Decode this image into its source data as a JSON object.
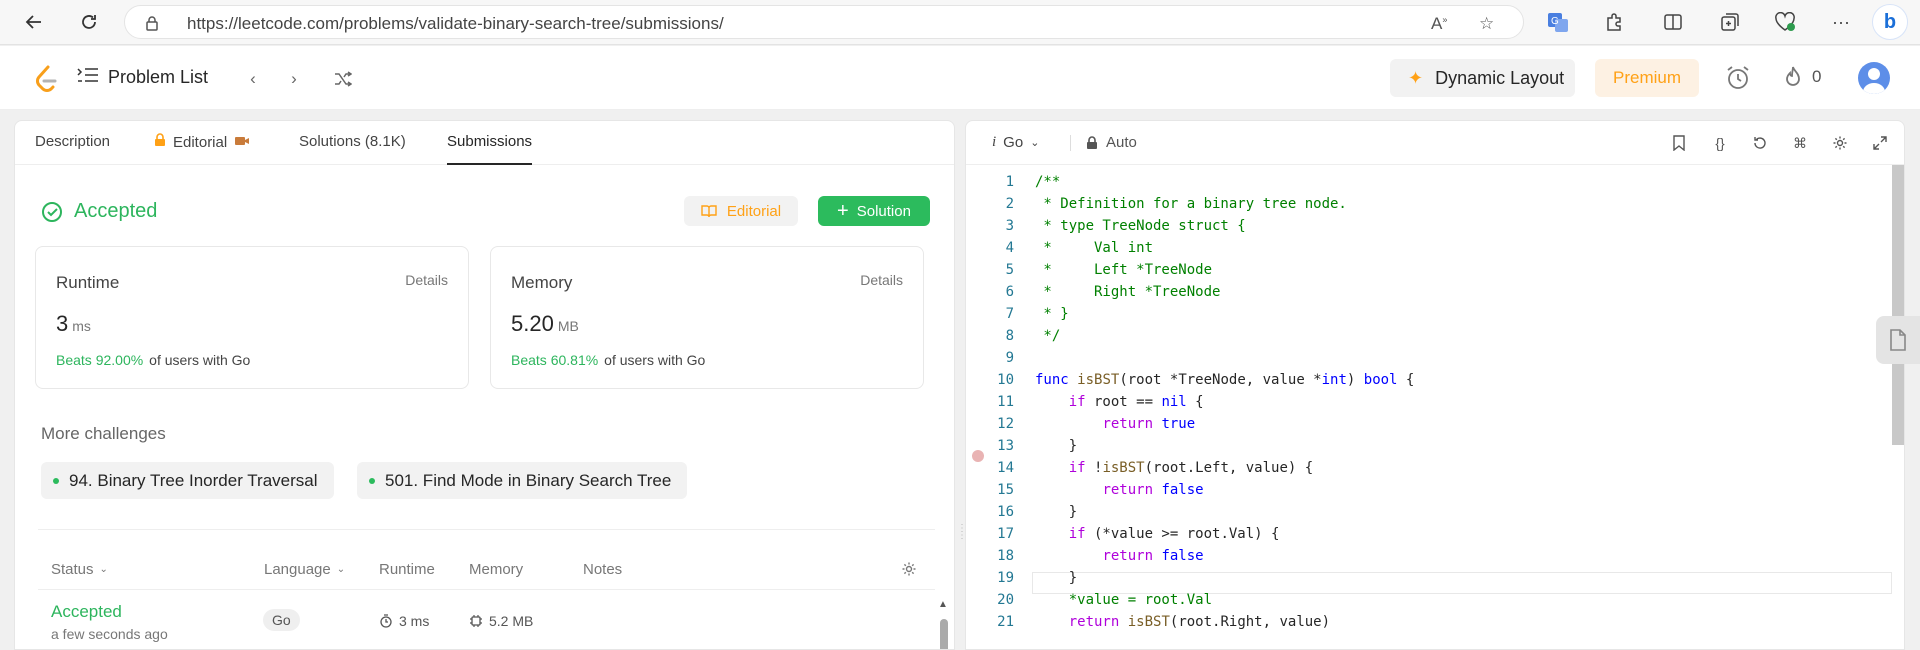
{
  "browser": {
    "url": "https://leetcode.com/problems/validate-binary-search-tree/submissions/",
    "icons": [
      "back-icon",
      "refresh-icon",
      "lock-icon",
      "read-aloud-icon",
      "favorite-star-icon",
      "translate-icon",
      "extensions-icon",
      "split-screen-icon",
      "collections-icon",
      "health-icon",
      "more-icon",
      "bing-icon"
    ]
  },
  "header": {
    "problem_list": "Problem List",
    "dynamic_layout": "Dynamic Layout",
    "premium": "Premium",
    "streak_count": "0"
  },
  "tabs": {
    "description": "Description",
    "editorial": "Editorial",
    "solutions": "Solutions (8.1K)",
    "submissions": "Submissions"
  },
  "result": {
    "status": "Accepted",
    "editorial_btn": "Editorial",
    "solution_btn": "Solution",
    "runtime": {
      "label": "Runtime",
      "details": "Details",
      "value": "3",
      "unit": "ms",
      "beats": "Beats 92.00%",
      "suffix": "of users with Go"
    },
    "memory": {
      "label": "Memory",
      "details": "Details",
      "value": "5.20",
      "unit": "MB",
      "beats": "Beats 60.81%",
      "suffix": "of users with Go"
    }
  },
  "more_challenges": {
    "title": "More challenges",
    "items": [
      "94. Binary Tree Inorder Traversal",
      "501. Find Mode in Binary Search Tree"
    ]
  },
  "table": {
    "headers": [
      "Status",
      "Language",
      "Runtime",
      "Memory",
      "Notes"
    ],
    "rows": [
      {
        "status": "Accepted",
        "time": "a few seconds ago",
        "language": "Go",
        "runtime": "3 ms",
        "memory": "5.2 MB"
      }
    ]
  },
  "editor": {
    "language": "Go",
    "mode": "Auto",
    "lines": [
      "/**",
      " * Definition for a binary tree node.",
      " * type TreeNode struct {",
      " *     Val int",
      " *     Left *TreeNode",
      " *     Right *TreeNode",
      " * }",
      " */",
      "",
      "func isBST(root *TreeNode, value *int) bool {",
      "    if root == nil {",
      "        return true",
      "    }",
      "    if !isBST(root.Left, value) {",
      "        return false",
      "    }",
      "    if (*value >= root.Val) {",
      "        return false",
      "    }",
      "    *value = root.Val",
      "    return isBST(root.Right, value)"
    ],
    "line_numbers": [
      "1",
      "2",
      "3",
      "4",
      "5",
      "6",
      "7",
      "8",
      "9",
      "10",
      "11",
      "12",
      "13",
      "14",
      "15",
      "16",
      "17",
      "18",
      "19",
      "20",
      "21"
    ]
  },
  "colors": {
    "accepted": "#2db55d",
    "premium": "#ffa116",
    "solution_bg": "#2cbb5d"
  }
}
